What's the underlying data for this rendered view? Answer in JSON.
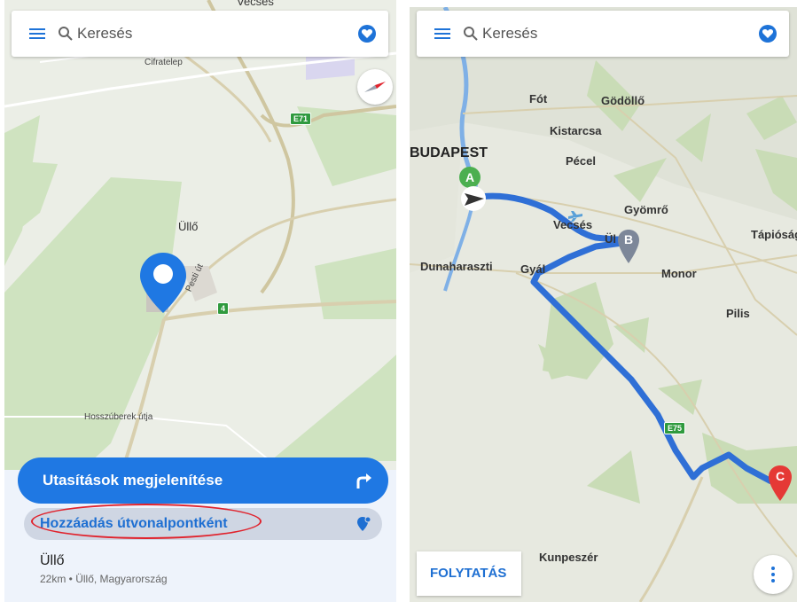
{
  "left_screen": {
    "search": {
      "placeholder": "Keresés"
    },
    "map_labels": {
      "cifratelep": "Cifratelep",
      "e71": "E71",
      "ullo": "Üllő",
      "pesti_ut": "Pesti út",
      "road4": "4",
      "hosszuberek": "Hosszúberek útja",
      "vecses_top": "Vecsés"
    },
    "directions_button": "Utasítások megjelenítése",
    "add_waypoint_button": "Hozzáadás útvonalpontként",
    "place": {
      "name": "Üllő",
      "details": "22km • Üllő, Magyarország"
    }
  },
  "right_screen": {
    "search": {
      "placeholder": "Keresés"
    },
    "map_labels": {
      "fot": "Fót",
      "godollo": "Gödöllő",
      "kistarcsa": "Kistarcsa",
      "budapest": "BUDAPEST",
      "pecel": "Pécel",
      "vecses": "Vecsés",
      "gyomro": "Gyömrő",
      "tapiosag": "Tápióság",
      "dunaharaszti": "Dunaharaszti",
      "gyal": "Gyál",
      "ullo_short": "Ül",
      "monor": "Monor",
      "pilis": "Pilis",
      "e75": "E75",
      "kunpeszer": "Kunpeszér"
    },
    "markers": {
      "a": "A",
      "b": "B",
      "c": "C"
    },
    "continue_button": "FOLYTATÁS"
  },
  "colors": {
    "accent": "#1f78e3",
    "route": "#2f6fd6",
    "highlight_ellipse": "#e0232d",
    "marker_a": "#4caf50",
    "marker_b": "#7d8799",
    "marker_c": "#e53935"
  },
  "icons": [
    "menu-icon",
    "search-icon",
    "favorites-heart-icon",
    "compass-icon",
    "location-pin-icon",
    "turn-right-arrow-icon",
    "add-waypoint-pin-icon",
    "more-vertical-icon",
    "navigation-arrow-icon"
  ]
}
